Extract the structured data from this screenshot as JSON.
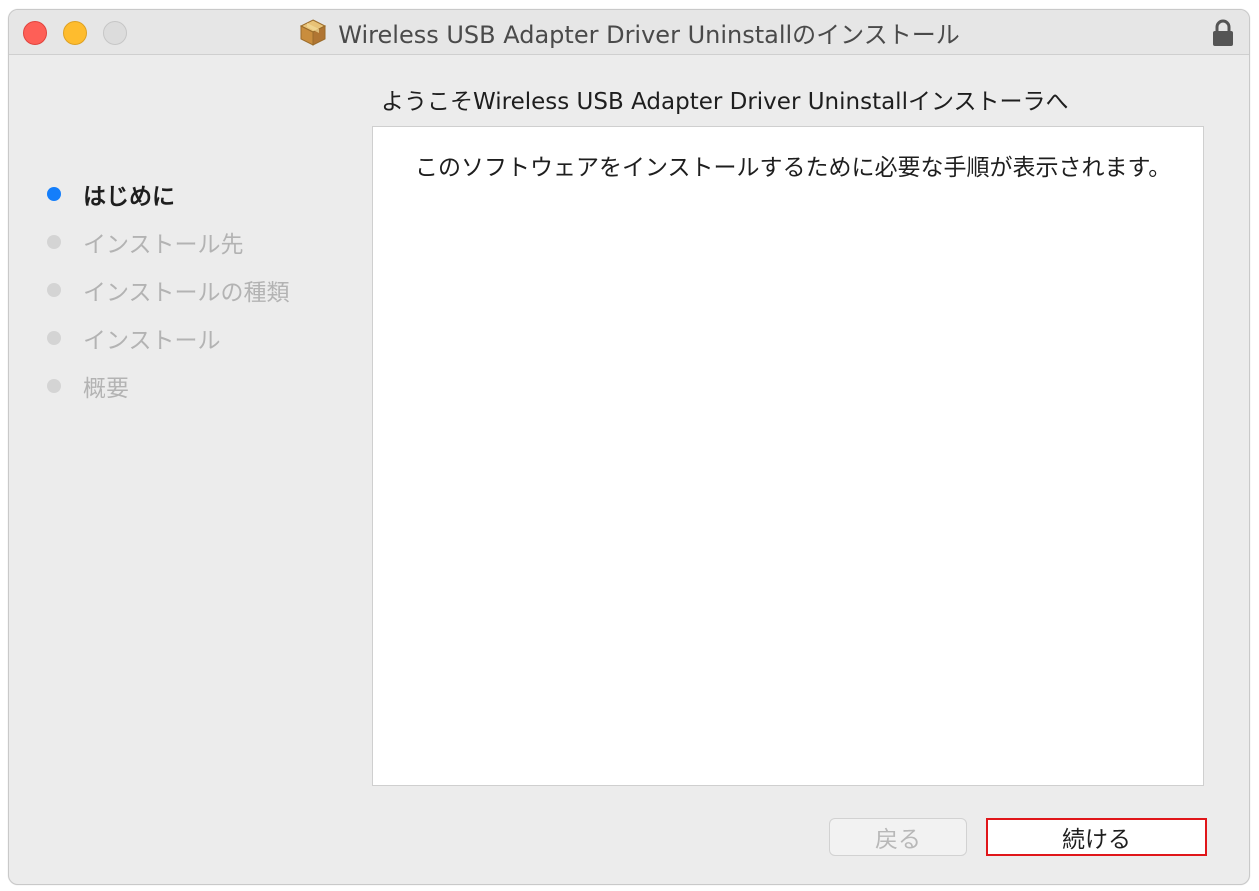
{
  "window": {
    "title": "Wireless USB Adapter Driver Uninstallのインストール",
    "icons": {
      "app": "package-icon",
      "lock": "lock-icon"
    }
  },
  "heading": "ようこそWireless USB Adapter Driver Uninstallインストーラへ",
  "sidebar": {
    "steps": [
      {
        "label": "はじめに",
        "active": true
      },
      {
        "label": "インストール先",
        "active": false
      },
      {
        "label": "インストールの種類",
        "active": false
      },
      {
        "label": "インストール",
        "active": false
      },
      {
        "label": "概要",
        "active": false
      }
    ]
  },
  "content": {
    "text": "このソフトウェアをインストールするために必要な手順が表示されます。"
  },
  "buttons": {
    "back": {
      "label": "戻る",
      "enabled": false
    },
    "continue": {
      "label": "続ける",
      "enabled": true
    }
  },
  "colors": {
    "active_step": "#147efb",
    "inactive_step": "#d4d4d4",
    "highlight_border": "#e0161a"
  }
}
